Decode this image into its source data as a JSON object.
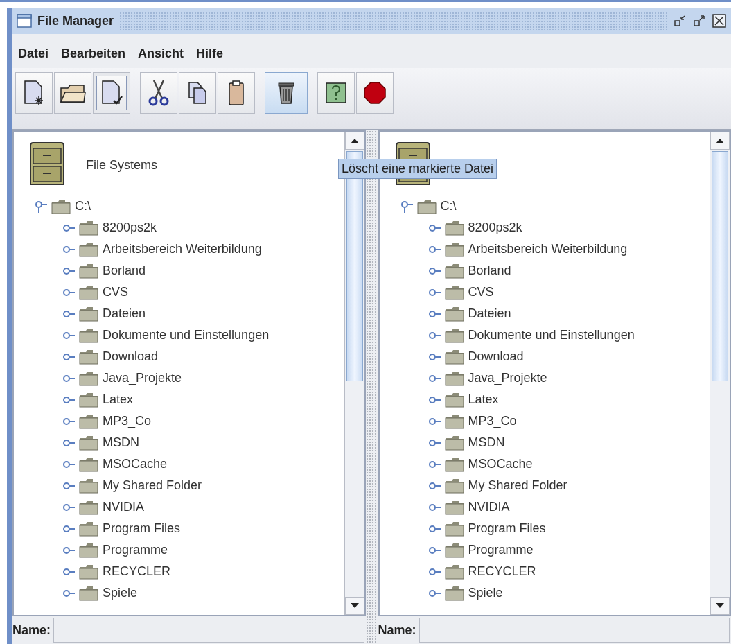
{
  "window": {
    "title": "File Manager"
  },
  "menu": [
    {
      "label": "Datei"
    },
    {
      "label": "Bearbeiten"
    },
    {
      "label": "Ansicht"
    },
    {
      "label": "Hilfe"
    }
  ],
  "toolbar": [
    [
      {
        "kind": "new",
        "highlighted": false,
        "selected": false
      },
      {
        "kind": "open",
        "highlighted": false,
        "selected": false
      },
      {
        "kind": "save",
        "highlighted": false,
        "selected": true
      }
    ],
    [
      {
        "kind": "cut",
        "highlighted": false,
        "selected": false
      },
      {
        "kind": "copy",
        "highlighted": false,
        "selected": false
      },
      {
        "kind": "paste",
        "highlighted": false,
        "selected": false
      }
    ],
    [
      {
        "kind": "delete",
        "highlighted": true,
        "selected": false
      }
    ],
    [
      {
        "kind": "help",
        "highlighted": false,
        "selected": false
      },
      {
        "kind": "stop",
        "highlighted": false,
        "selected": false
      }
    ]
  ],
  "tooltip": "Löscht eine markierte Datei",
  "panes": [
    {
      "header": "File Systems",
      "tree": [
        {
          "label": "C:\\",
          "expanded": true,
          "children": [
            {
              "label": "8200ps2k",
              "expanded": false
            },
            {
              "label": "Arbeitsbereich Weiterbildung",
              "expanded": false
            },
            {
              "label": "Borland",
              "expanded": false
            },
            {
              "label": "CVS",
              "expanded": false
            },
            {
              "label": "Dateien",
              "expanded": false
            },
            {
              "label": "Dokumente und Einstellungen",
              "expanded": false
            },
            {
              "label": "Download",
              "expanded": false
            },
            {
              "label": "Java_Projekte",
              "expanded": false
            },
            {
              "label": "Latex",
              "expanded": false
            },
            {
              "label": "MP3_Co",
              "expanded": false
            },
            {
              "label": "MSDN",
              "expanded": false
            },
            {
              "label": "MSOCache",
              "expanded": false
            },
            {
              "label": "My Shared Folder",
              "expanded": false
            },
            {
              "label": "NVIDIA",
              "expanded": false
            },
            {
              "label": "Program Files",
              "expanded": false
            },
            {
              "label": "Programme",
              "expanded": false
            },
            {
              "label": "RECYCLER",
              "expanded": false
            },
            {
              "label": "Spiele",
              "expanded": false
            }
          ]
        }
      ],
      "name_label": "Name:"
    },
    {
      "tree": [
        {
          "label": "C:\\",
          "expanded": true,
          "children": [
            {
              "label": "8200ps2k",
              "expanded": false
            },
            {
              "label": "Arbeitsbereich Weiterbildung",
              "expanded": false
            },
            {
              "label": "Borland",
              "expanded": false
            },
            {
              "label": "CVS",
              "expanded": false
            },
            {
              "label": "Dateien",
              "expanded": false
            },
            {
              "label": "Dokumente und Einstellungen",
              "expanded": false
            },
            {
              "label": "Download",
              "expanded": false
            },
            {
              "label": "Java_Projekte",
              "expanded": false
            },
            {
              "label": "Latex",
              "expanded": false
            },
            {
              "label": "MP3_Co",
              "expanded": false
            },
            {
              "label": "MSDN",
              "expanded": false
            },
            {
              "label": "MSOCache",
              "expanded": false
            },
            {
              "label": "My Shared Folder",
              "expanded": false
            },
            {
              "label": "NVIDIA",
              "expanded": false
            },
            {
              "label": "Program Files",
              "expanded": false
            },
            {
              "label": "Programme",
              "expanded": false
            },
            {
              "label": "RECYCLER",
              "expanded": false
            },
            {
              "label": "Spiele",
              "expanded": false
            }
          ]
        }
      ],
      "name_label": "Name:"
    }
  ]
}
